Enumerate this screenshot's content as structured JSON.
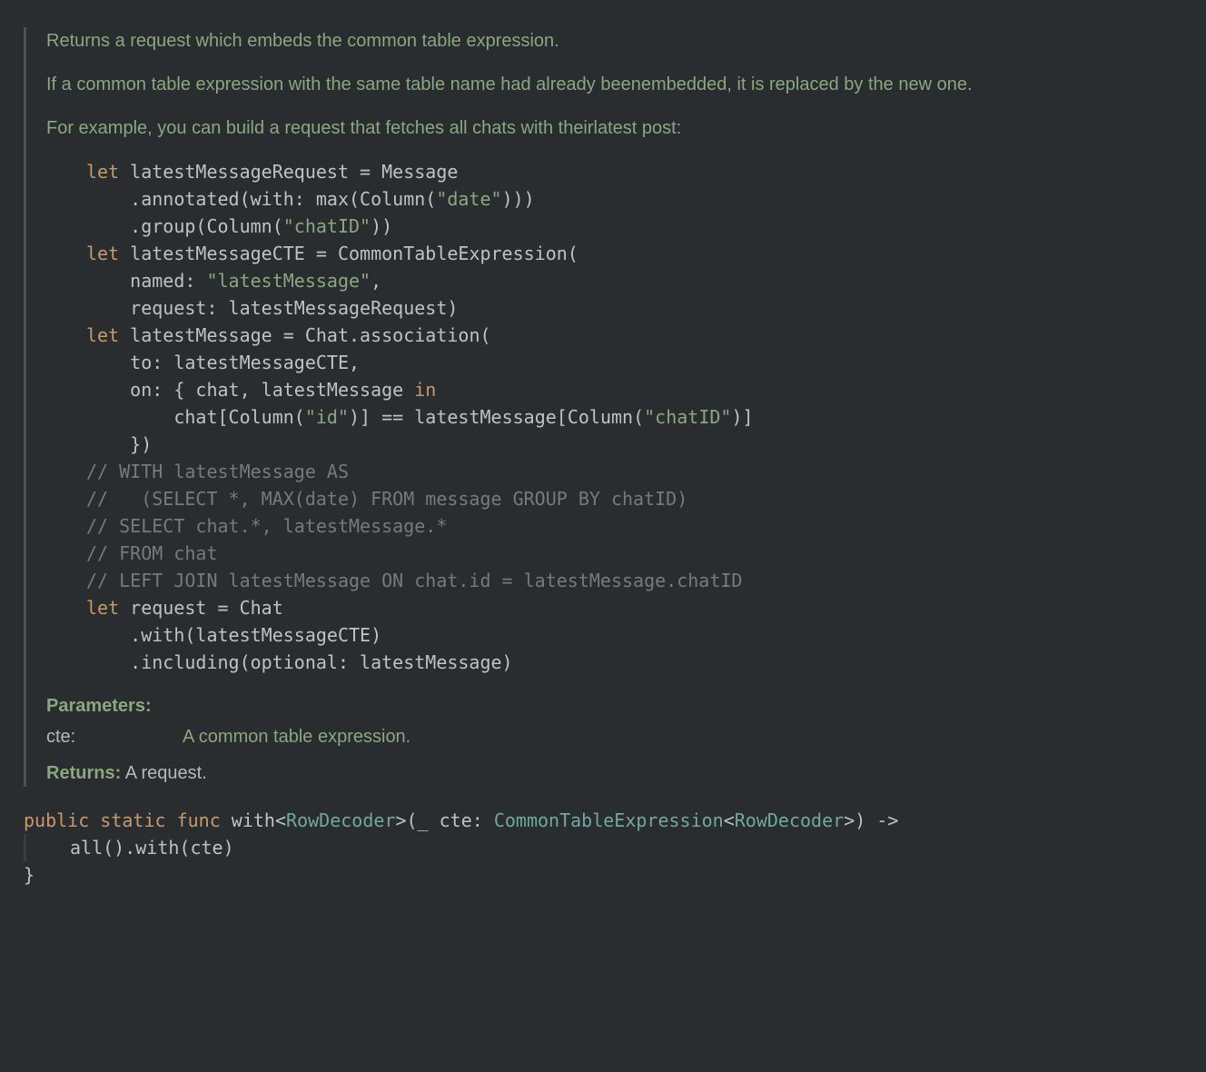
{
  "doc": {
    "para1": "Returns a request which embeds the common table expression.",
    "para2": "If a common table expression with the same table name had already beenembedded, it is replaced by the new one.",
    "para3": "For example, you can build a request that fetches all chats with theirlatest post:",
    "params_heading": "Parameters:",
    "param_name": "cte:",
    "param_desc": "A common table expression.",
    "returns_label": "Returns:",
    "returns_value": "A request."
  },
  "code": {
    "kw_let1": "let",
    "id_latestMessageRequest": " latestMessageRequest = Message",
    "line2a": "    .annotated(with: max(Column(",
    "str_date": "\"date\"",
    "line2b": ")))",
    "line3a": "    .group(Column(",
    "str_chatID1": "\"chatID\"",
    "line3b": "))",
    "kw_let2": "let",
    "id_latestMessageCTE": " latestMessageCTE = CommonTableExpression(",
    "line5a": "    named: ",
    "str_latestMessage": "\"latestMessage\"",
    "line5b": ",",
    "line6": "    request: latestMessageRequest)",
    "kw_let3": "let",
    "id_latestMessage": " latestMessage = Chat.association(",
    "line8": "    to: latestMessageCTE,",
    "line9a": "    on: { chat, latestMessage ",
    "kw_in": "in",
    "line10a": "        chat[Column(",
    "str_id": "\"id\"",
    "line10b": ")] == latestMessage[Column(",
    "str_chatID2": "\"chatID\"",
    "line10c": ")]",
    "line11": "    })",
    "cmt1": "// WITH latestMessage AS",
    "cmt2": "//   (SELECT *, MAX(date) FROM message GROUP BY chatID)",
    "cmt3": "// SELECT chat.*, latestMessage.*",
    "cmt4": "// FROM chat",
    "cmt5": "// LEFT JOIN latestMessage ON chat.id = latestMessage.chatID",
    "kw_let4": "let",
    "id_request": " request = Chat",
    "line18": "    .with(latestMessageCTE)",
    "line19": "    .including(optional: latestMessage)"
  },
  "sig": {
    "kw_public": "public",
    "kw_static": "static",
    "kw_func": "func",
    "fn_with": " with",
    "lt": "<",
    "type_RowDecoder1": "RowDecoder",
    "gt": ">",
    "open": "(_ cte",
    "colon": ": ",
    "type_CTE": "CommonTableExpression",
    "lt2": "<",
    "type_RowDecoder2": "RowDecoder",
    "gt2_close": ">) -> ",
    "body": "all().with(cte)",
    "rbrace": "}"
  }
}
